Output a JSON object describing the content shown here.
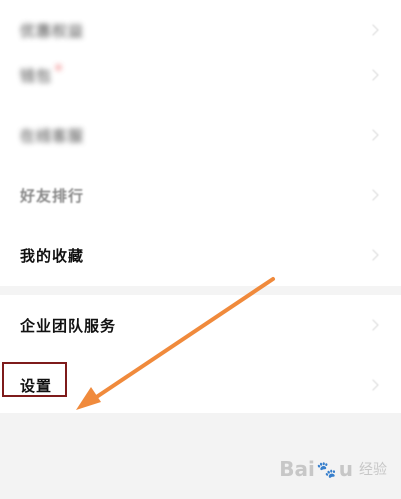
{
  "menu": {
    "items": [
      {
        "label": "优惠权益",
        "state": "blurred"
      },
      {
        "label": "钱包",
        "state": "blurred",
        "badge_dot": true
      },
      {
        "label": "在线客服",
        "state": "blurred"
      },
      {
        "label": "好友排行",
        "state": "faded"
      },
      {
        "label": "我的收藏",
        "state": "normal"
      },
      {
        "label": "企业团队服务",
        "state": "normal"
      },
      {
        "label": "设置",
        "state": "normal"
      }
    ]
  },
  "annotation": {
    "highlight_target": "设置",
    "highlight_color": "#7e1b1b",
    "arrow_color": "#f08a3c"
  },
  "watermark": {
    "brand_left": "Bai",
    "brand_right": "u",
    "brand_cn": "经验"
  }
}
